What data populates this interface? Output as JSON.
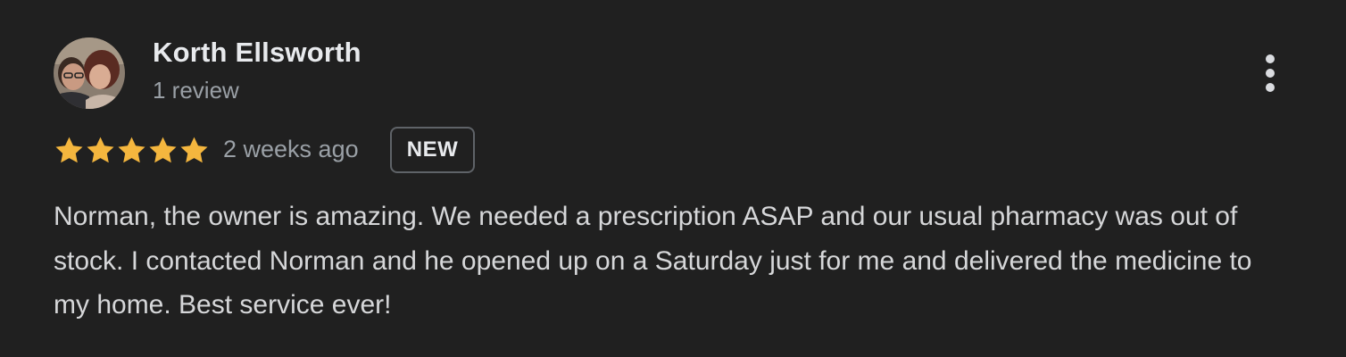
{
  "review": {
    "reviewer_name": "Korth Ellsworth",
    "review_count": "1 review",
    "rating": 5,
    "rating_max": 5,
    "date": "2 weeks ago",
    "badge": "NEW",
    "text": "Norman, the owner is amazing. We needed a prescription ASAP and our usual pharmacy was out of stock. I contacted Norman and he opened up on a Saturday just for me and delivered the medicine to my home. Best service ever!"
  },
  "icons": {
    "avatar": "avatar-photo",
    "more": "more-vert-icon",
    "star": "star-icon"
  },
  "colors": {
    "background": "#202020",
    "star": "#f4b63e",
    "text_primary": "#e8eaed",
    "text_secondary": "#9aa0a6"
  }
}
